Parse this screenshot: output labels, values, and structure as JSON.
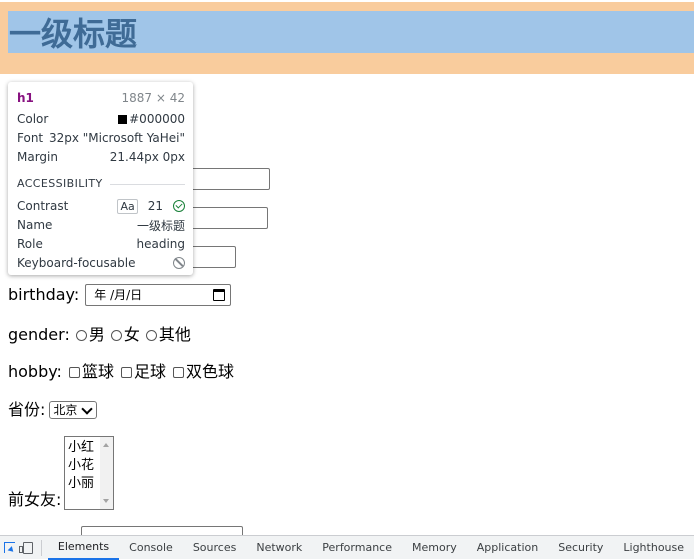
{
  "page": {
    "heading": "一级标题",
    "birthday_label": "birthday:",
    "birthday_placeholder": "年 /月/日",
    "gender_label": "gender:",
    "gender_options": [
      "男",
      "女",
      "其他"
    ],
    "hobby_label": "hobby:",
    "hobby_options": [
      "篮球",
      "足球",
      "双色球"
    ],
    "province_label": "省份:",
    "province_selected": "北京",
    "girlfriend_label": "前女友:",
    "girlfriend_options": [
      "小红",
      "小花",
      "小丽"
    ]
  },
  "tooltip": {
    "tag": "h1",
    "size": "1887 × 42",
    "color_label": "Color",
    "color_value": "#000000",
    "font_label": "Font",
    "font_value": "32px \"Microsoft YaHei\"",
    "margin_label": "Margin",
    "margin_value": "21.44px 0px",
    "section": "ACCESSIBILITY",
    "contrast_label": "Contrast",
    "contrast_aa": "Aa",
    "contrast_value": "21",
    "name_label": "Name",
    "name_value": "一级标题",
    "role_label": "Role",
    "role_value": "heading",
    "keyboard_label": "Keyboard-focusable"
  },
  "devtools": {
    "tabs": [
      "Elements",
      "Console",
      "Sources",
      "Network",
      "Performance",
      "Memory",
      "Application",
      "Security",
      "Lighthouse"
    ],
    "active_tab": "Elements"
  },
  "colors": {
    "margin_overlay": "#f9cc9d",
    "content_overlay": "#a0c5e8",
    "active_tab": "#1a73e8"
  }
}
